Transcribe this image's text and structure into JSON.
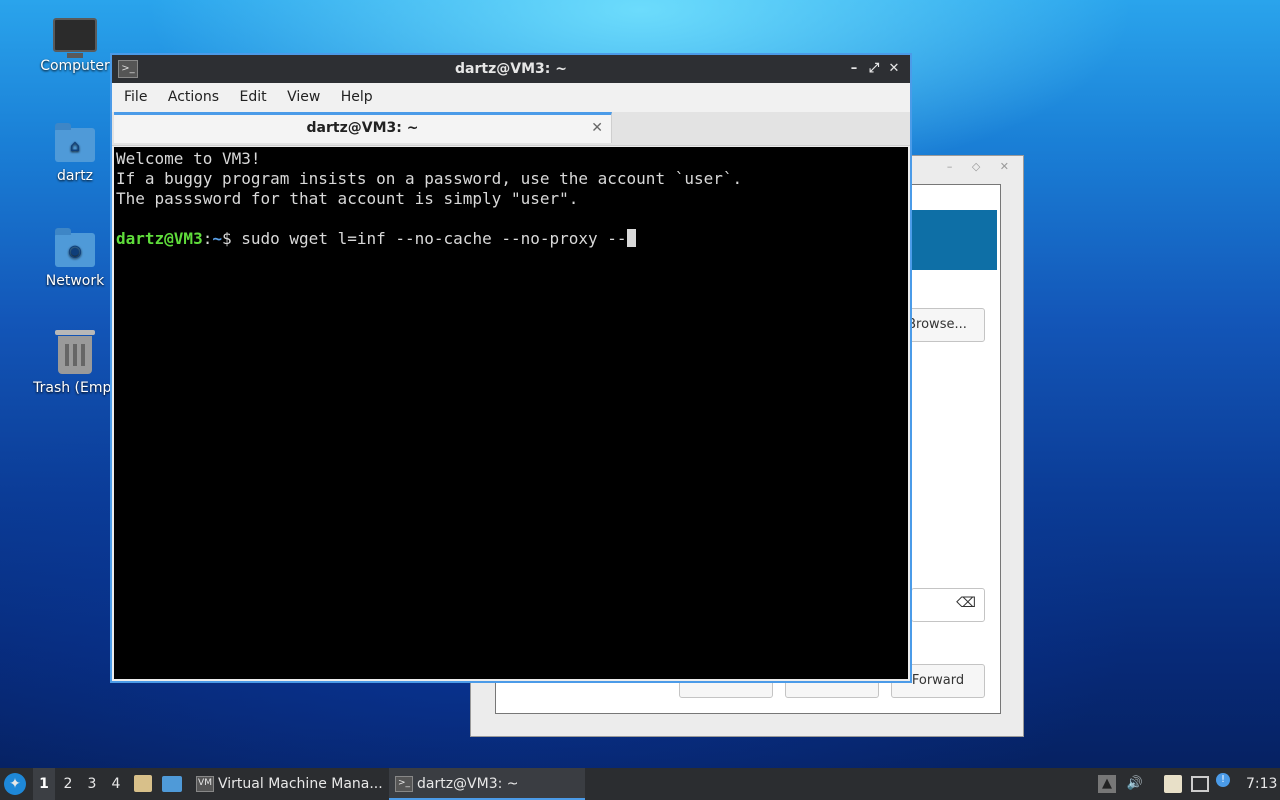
{
  "desktop": {
    "icons": [
      {
        "label": "Computer"
      },
      {
        "label": "dartz"
      },
      {
        "label": "Network"
      },
      {
        "label": "Trash (Empt"
      }
    ]
  },
  "background_window": {
    "browse_label": "Browse...",
    "forward_label": "Forward",
    "clear_icon": "⌫"
  },
  "terminal": {
    "title": "dartz@VM3: ~",
    "menu": [
      "File",
      "Actions",
      "Edit",
      "View",
      "Help"
    ],
    "tab_label": "dartz@VM3: ~",
    "lines": [
      "Welcome to VM3!",
      "If a buggy program insists on a password, use the account `user`.",
      "The passsword for that account is simply \"user\"."
    ],
    "prompt_user": "dartz@VM3",
    "prompt_sep": ":",
    "prompt_dir": "~",
    "prompt_symbol": "$ ",
    "command": "sudo wget l=inf --no-cache --no-proxy --"
  },
  "taskbar": {
    "workspaces": [
      "1",
      "2",
      "3",
      "4"
    ],
    "tasks": [
      {
        "label": "Virtual Machine Mana...",
        "icon": "VM"
      },
      {
        "label": "dartz@VM3: ~",
        "icon": ">_"
      }
    ],
    "clock": "7:13"
  },
  "colors": {
    "accent": "#4b9be8",
    "prompt_user": "#5fdc3b",
    "prompt_dir": "#5aa0e8"
  }
}
